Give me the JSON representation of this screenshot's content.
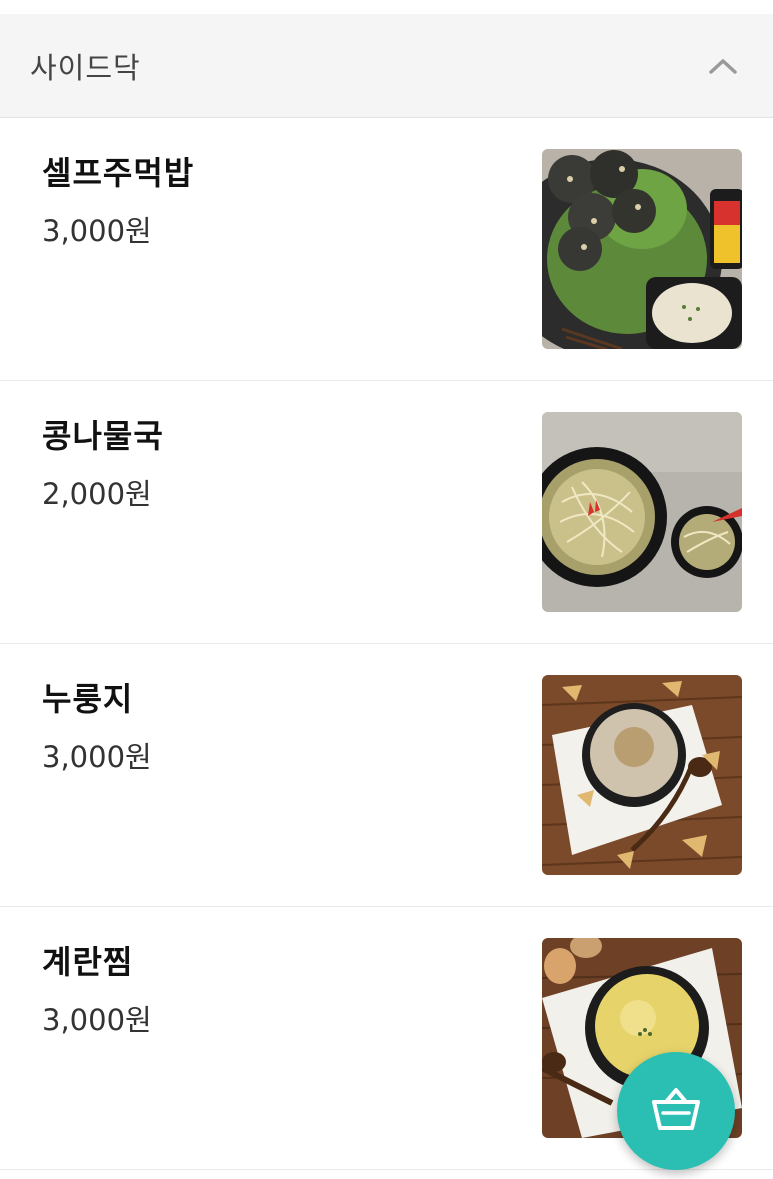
{
  "section": {
    "title": "사이드닥",
    "collapse_icon": "chevron-up-icon"
  },
  "items": [
    {
      "name": "셀프주먹밥",
      "price": "3,000원",
      "photo": "rice-balls-photo"
    },
    {
      "name": "콩나물국",
      "price": "2,000원",
      "photo": "bean-sprout-soup-photo"
    },
    {
      "name": "누룽지",
      "price": "3,000원",
      "photo": "nurungji-photo"
    },
    {
      "name": "계란찜",
      "price": "3,000원",
      "photo": "steamed-egg-photo"
    }
  ],
  "cart_button": {
    "icon": "basket-icon",
    "color": "#2bbfb3"
  }
}
